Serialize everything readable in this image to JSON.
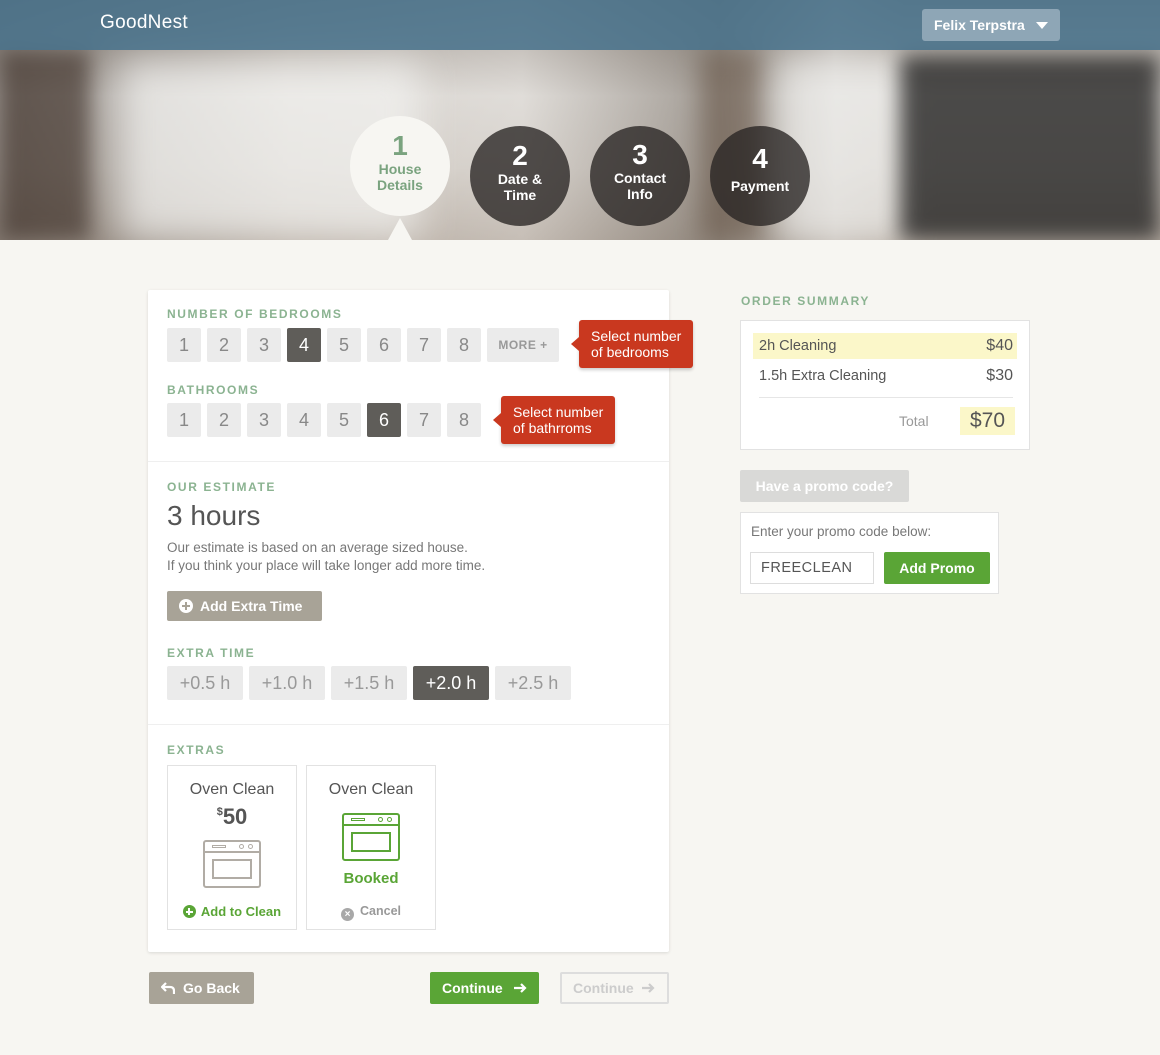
{
  "header": {
    "logo": "GoodNest",
    "user_name": "Felix Terpstra"
  },
  "steps": [
    {
      "num": "1",
      "label_line1": "House",
      "label_line2": "Details",
      "active": true
    },
    {
      "num": "2",
      "label_line1": "Date &",
      "label_line2": "Time",
      "active": false
    },
    {
      "num": "3",
      "label_line1": "Contact",
      "label_line2": "Info",
      "active": false
    },
    {
      "num": "4",
      "label_line1": "Payment",
      "label_line2": "",
      "active": false
    }
  ],
  "bedrooms": {
    "title": "NUMBER OF BEDROOMS",
    "options": [
      "1",
      "2",
      "3",
      "4",
      "5",
      "6",
      "7",
      "8"
    ],
    "selected": "4",
    "more_label": "MORE +",
    "tooltip_line1": "Select number",
    "tooltip_line2": "of bedrooms"
  },
  "bathrooms": {
    "title": "BATHROOMS",
    "options": [
      "1",
      "2",
      "3",
      "4",
      "5",
      "6",
      "7",
      "8"
    ],
    "selected": "6",
    "tooltip_line1": "Select number",
    "tooltip_line2": "of bathrroms"
  },
  "estimate": {
    "title": "OUR ESTIMATE",
    "value": "3 hours",
    "line1": "Our estimate is based on an average sized house.",
    "line2": "If you think your place will take longer add more time.",
    "add_extra_label": "Add Extra Time"
  },
  "extra_time": {
    "title": "EXTRA TIME",
    "options": [
      "+0.5 h",
      "+1.0 h",
      "+1.5 h",
      "+2.0 h",
      "+2.5 h"
    ],
    "selected": "+2.0 h"
  },
  "extras": {
    "title": "EXTRAS",
    "items": [
      {
        "title": "Oven Clean",
        "currency": "$",
        "price": "50",
        "action": "Add to Clean"
      },
      {
        "title": "Oven Clean",
        "status": "Booked",
        "action": "Cancel"
      }
    ]
  },
  "nav": {
    "back_label": "Go Back",
    "continue_label": "Continue",
    "continue_disabled_label": "Continue"
  },
  "order_summary": {
    "title": "ORDER SUMMARY",
    "lines": [
      {
        "label": "2h Cleaning",
        "amount": "$40"
      },
      {
        "label": "1.5h Extra Cleaning",
        "amount": "$30"
      }
    ],
    "total_label": "Total",
    "total_value": "$70"
  },
  "promo": {
    "toggle_label": "Have a promo code?",
    "prompt": "Enter your promo code below:",
    "input_value": "FREECLEAN",
    "button_label": "Add Promo"
  },
  "colors": {
    "accent_green": "#5aa536",
    "header_blue": "#4a738c",
    "tooltip_red": "#c9381f",
    "section_title": "#8bb391"
  }
}
